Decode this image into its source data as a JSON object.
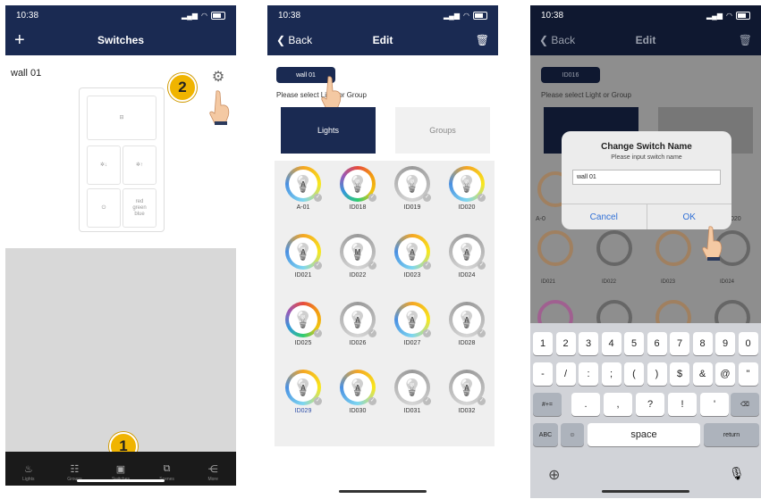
{
  "phone1": {
    "status_time": "10:38",
    "nav_title": "Switches",
    "wall_label": "wall 01",
    "color_button": "red\ngreen\nblue",
    "step_badge_top": "2",
    "step_badge_bottom": "1",
    "tabs": [
      {
        "label": "Lights",
        "icon": "bulb-icon"
      },
      {
        "label": "Groups",
        "icon": "groups-icon"
      },
      {
        "label": "Switches",
        "icon": "switch-icon"
      },
      {
        "label": "Scenes",
        "icon": "scenes-icon"
      },
      {
        "label": "More",
        "icon": "share-icon"
      }
    ]
  },
  "phone2": {
    "status_time": "10:38",
    "back_label": "Back",
    "nav_title": "Edit",
    "switch_chip": "wall 01",
    "select_text": "Please select Light or Group",
    "seg_lights": "Lights",
    "seg_groups": "Groups",
    "lights": [
      {
        "label": "A-01",
        "letter": "A",
        "ring": "multi"
      },
      {
        "label": "ID018",
        "letter": "",
        "ring": "rainbow"
      },
      {
        "label": "ID019",
        "letter": "",
        "ring": "grey"
      },
      {
        "label": "ID020",
        "letter": "",
        "ring": "multi"
      },
      {
        "label": "ID021",
        "letter": "A",
        "ring": "multi"
      },
      {
        "label": "ID022",
        "letter": "M",
        "ring": "grey"
      },
      {
        "label": "ID023",
        "letter": "A",
        "ring": "multi"
      },
      {
        "label": "ID024",
        "letter": "A",
        "ring": "grey"
      },
      {
        "label": "ID025",
        "letter": "",
        "ring": "rainbow"
      },
      {
        "label": "ID026",
        "letter": "A",
        "ring": "grey"
      },
      {
        "label": "ID027",
        "letter": "A",
        "ring": "multi"
      },
      {
        "label": "ID028",
        "letter": "A",
        "ring": "grey"
      },
      {
        "label": "ID029",
        "letter": "A",
        "ring": "multi"
      },
      {
        "label": "ID030",
        "letter": "A",
        "ring": "multi"
      },
      {
        "label": "ID031",
        "letter": "",
        "ring": "grey"
      },
      {
        "label": "ID032",
        "letter": "A",
        "ring": "grey"
      }
    ]
  },
  "phone3": {
    "status_time": "10:38",
    "back_label": "Back",
    "nav_title": "Edit",
    "switch_chip": "ID016",
    "select_text": "Please select Light or Group",
    "alert_title": "Change Switch Name",
    "alert_message": "Please input switch name",
    "alert_input_value": "wall 01",
    "cancel_label": "Cancel",
    "ok_label": "OK",
    "bg_labels": [
      "A-0",
      "020",
      "ID021",
      "ID022",
      "ID023",
      "ID024"
    ],
    "keyboard": {
      "row1": [
        "1",
        "2",
        "3",
        "4",
        "5",
        "6",
        "7",
        "8",
        "9",
        "0"
      ],
      "row2": [
        "-",
        "/",
        ":",
        ";",
        "(",
        ")",
        "$",
        "&",
        "@",
        "\""
      ],
      "row3_left": "#+=",
      "row3": [
        ".",
        ",",
        "?",
        "!",
        "'"
      ],
      "row4_left": "ABC",
      "space": "space",
      "return": "return"
    }
  },
  "colors": {
    "navy": "#1a2a52",
    "badge": "#f0b400",
    "ios_blue": "#2f6fd6"
  }
}
